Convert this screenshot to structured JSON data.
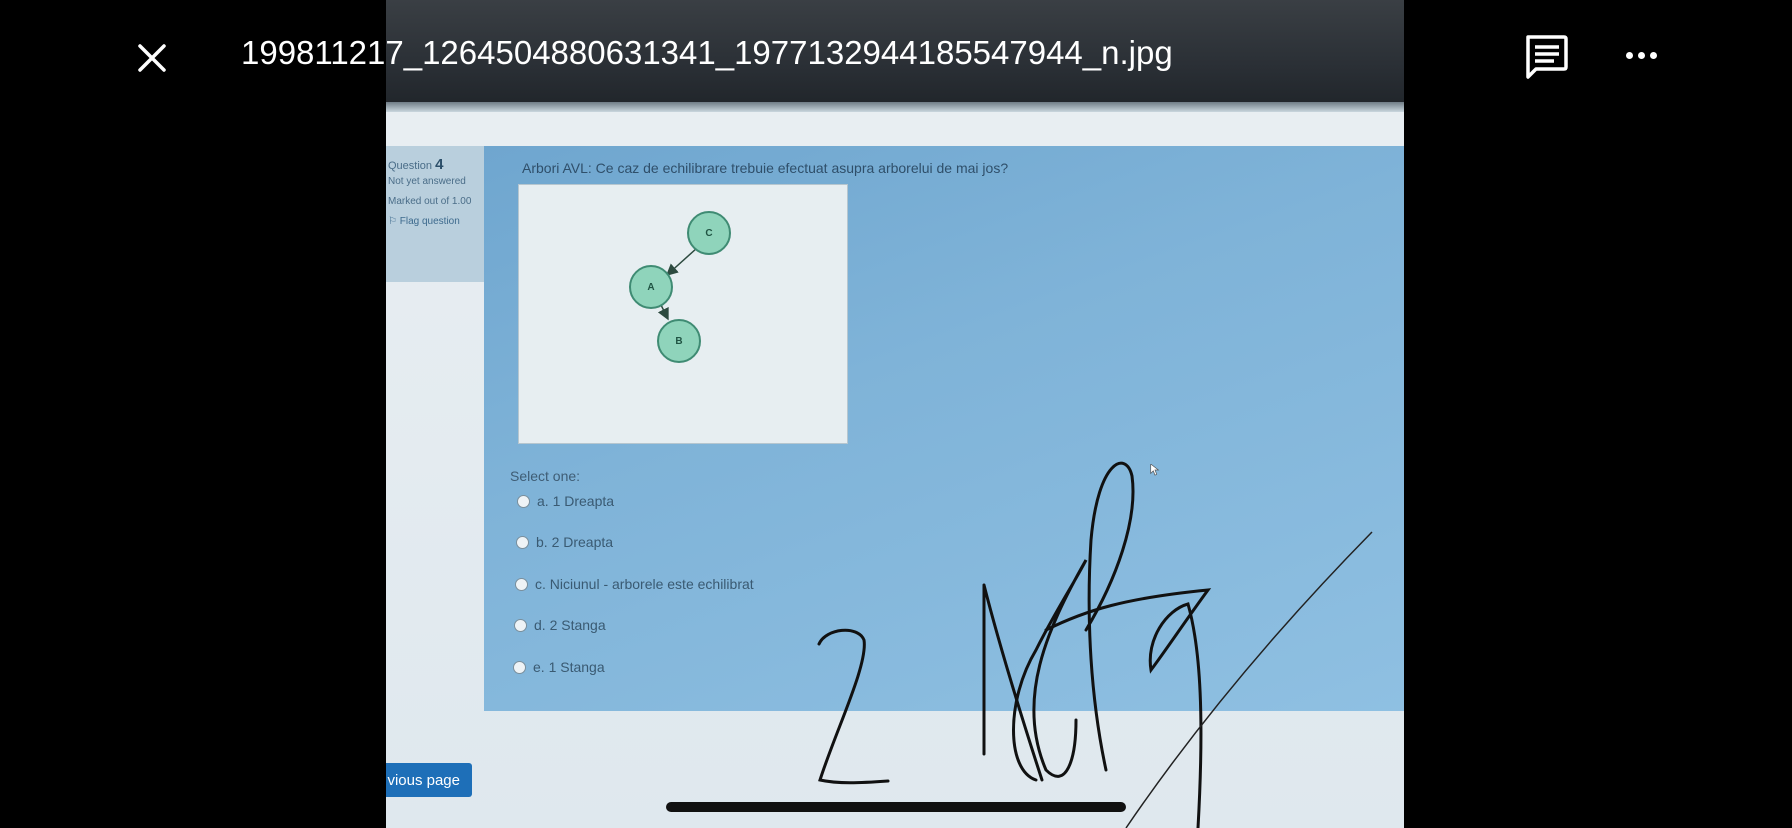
{
  "viewer": {
    "filename": "199811217_1264504880631341_1977132944185547944_n.jpg",
    "close_icon": "close-icon",
    "comment_icon": "comment-icon",
    "more_icon": "more-options-icon"
  },
  "quiz": {
    "info": {
      "question_label": "Question",
      "question_number": "4",
      "status": "Not yet answered",
      "marked": "Marked out of 1.00",
      "flag": "Flag question"
    },
    "question_text": "Arbori AVL: Ce caz de echilibrare trebuie efectuat asupra arborelui de mai jos?",
    "tree": {
      "nodes": [
        "C",
        "A",
        "B"
      ],
      "edges": [
        [
          "C",
          "A"
        ],
        [
          "A",
          "B"
        ]
      ]
    },
    "select_label": "Select one:",
    "options": [
      "a. 1 Dreapta",
      "b. 2 Dreapta",
      "c. Niciunul - arborele este echilibrat",
      "d. 2 Stanga",
      "e. 1 Stanga"
    ],
    "prev_button": "vious page"
  },
  "colors": {
    "panel": "#7fb3d8",
    "node_fill": "#8fd4bb",
    "button": "#1e6fb8"
  }
}
